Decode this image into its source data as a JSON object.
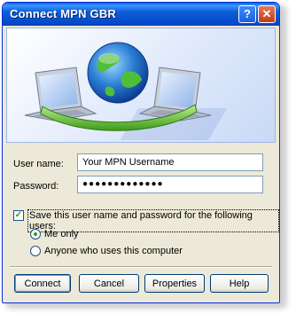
{
  "window": {
    "title": "Connect MPN GBR",
    "help_glyph": "?",
    "close_glyph": "✕"
  },
  "form": {
    "username_label": "User name:",
    "username_value": "Your MPN Username",
    "password_label": "Password:",
    "password_value": "●●●●●●●●●●●●●",
    "save_checkbox": {
      "checked": true,
      "label": "Save this user name and password for the following users:"
    },
    "radio_options": [
      {
        "label": "Me only",
        "selected": true
      },
      {
        "label": "Anyone who uses this computer",
        "selected": false
      }
    ]
  },
  "buttons": {
    "connect": "Connect",
    "cancel": "Cancel",
    "properties": "Properties",
    "help": "Help"
  },
  "colors": {
    "titlebar": "#0a5fd8",
    "window_bg": "#ece9d8",
    "accent_green": "#21a121",
    "border_blue": "#0831d9"
  },
  "icons": {
    "banner": "network-connection-globe-laptops-icon",
    "checkbox_mark": "✓"
  }
}
